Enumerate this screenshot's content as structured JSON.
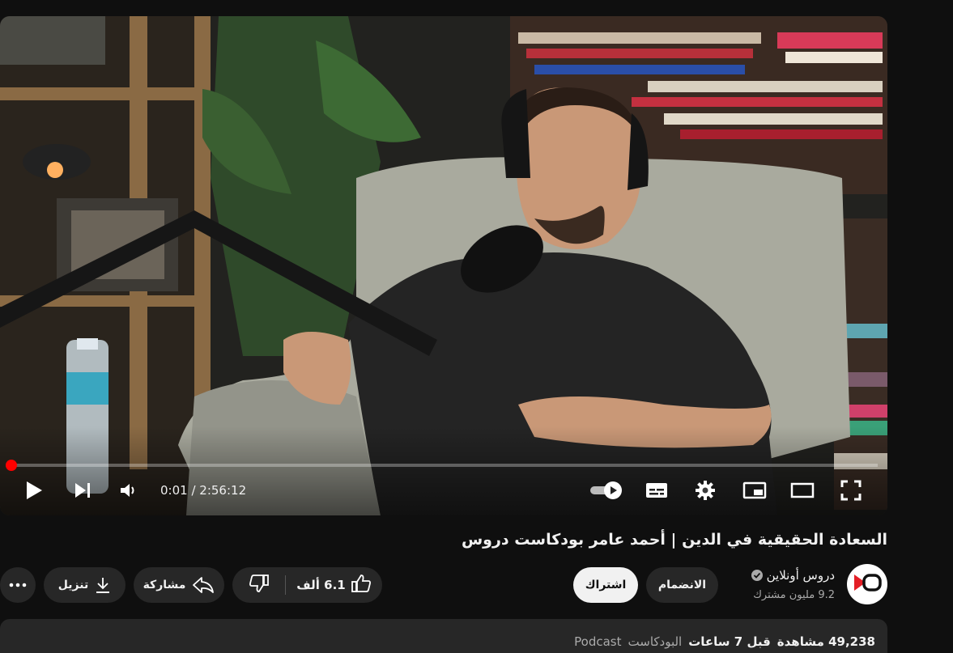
{
  "player": {
    "current_time": "0:01",
    "duration": "2:56:12",
    "time_separator": " / ",
    "progress_fraction": 0.0
  },
  "video": {
    "title": "السعادة الحقيقية في الدين | أحمد عامر بودكاست دروس"
  },
  "channel": {
    "name": "دروس أونلاين",
    "subscribers": "9.2 مليون مشترك"
  },
  "actions": {
    "join": "الانضمام",
    "subscribe": "اشتراك",
    "like_count": "6.1 ألف",
    "share": "مشاركة",
    "download": "تنزيل"
  },
  "description": {
    "views": "49,238 مشاهدة",
    "age": "قبل 7 ساعات",
    "tag_ar": "البودكاست",
    "tag_en": "Podcast"
  },
  "colors": {
    "progress": "#ff0000",
    "background": "#0f0f0f",
    "pill": "#272727"
  },
  "icons": [
    "play-icon",
    "next-icon",
    "volume-icon",
    "autoplay-toggle-icon",
    "subtitles-icon",
    "settings-icon",
    "miniplayer-icon",
    "theater-icon",
    "fullscreen-icon",
    "verified-icon",
    "like-icon",
    "dislike-icon",
    "share-icon",
    "download-icon",
    "more-icon",
    "channel-logo-icon"
  ]
}
